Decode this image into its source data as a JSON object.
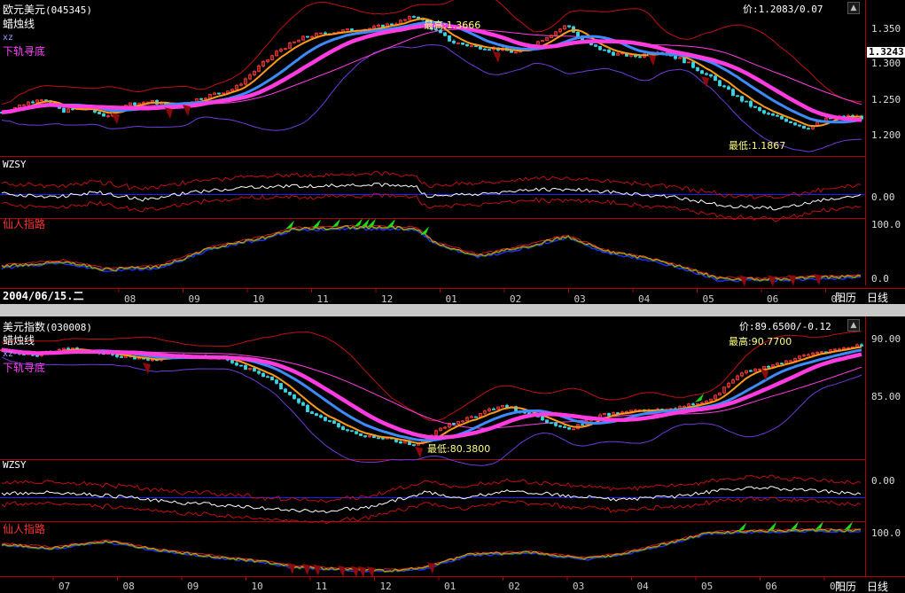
{
  "colors": {
    "bg": "#000000",
    "candle_up": "#ff3b3b",
    "candle_down": "#38d7e8",
    "ma_fast": "#ff9a1a",
    "ma_mid": "#3d8cff",
    "ma_slow": "#ff3ce0",
    "band_upper": "#c01010",
    "band_lower": "#6f3bd8",
    "oscillator": "#ffffff",
    "osc_band": "#c01010",
    "zero_line": "#2020ff",
    "signal_up": "#17e017",
    "signal_down": "#8b0a0a",
    "label_title": "#ffffff",
    "label_xz": "#9aa0ff",
    "label_lower": "#ff40ff",
    "label_xianren": "#ff3030",
    "hilo_text": "#ffff80"
  },
  "top": {
    "title": "欧元美元",
    "code": "(045345)",
    "price_label": "价:1.2083/0.07",
    "indicator": "蜡烛线",
    "sub1": "xz",
    "sub2": "下轨寻底",
    "high_label": "最高:1.3666",
    "low_label": "最低:1.1867",
    "current_value": "1.3243",
    "axis_ticks": [
      "1.350",
      "1.300",
      "1.250",
      "1.200"
    ],
    "osc_name": "WZSY",
    "osc_ticks": [
      "0.00"
    ],
    "xr_name": "仙人指路",
    "xr_ticks": [
      "100.0",
      "0.0"
    ]
  },
  "bottom": {
    "title": "美元指数",
    "code": "(030008)",
    "price_label": "价:89.6500/-0.12",
    "indicator": "蜡烛线",
    "sub1": "xz",
    "sub2": "下轨寻底",
    "high_label": "最高:90.7700",
    "low_label": "最低:80.3800",
    "axis_ticks": [
      "90.00",
      "85.00"
    ],
    "osc_name": "WZSY",
    "osc_ticks": [
      "0.00"
    ],
    "xr_name": "仙人指路",
    "xr_ticks": [
      "100.0"
    ]
  },
  "timebar": {
    "date": "2004/06/15.二",
    "months_top": [
      "08",
      "09",
      "10",
      "11",
      "12",
      "01",
      "02",
      "03",
      "04",
      "05",
      "06",
      "07"
    ],
    "months_bottom": [
      "07",
      "08",
      "09",
      "10",
      "11",
      "12",
      "01",
      "02",
      "03",
      "04",
      "05",
      "06",
      "07"
    ],
    "calendar_label": "阳历",
    "period_label": "日线"
  },
  "chart_data": [
    {
      "type": "candlestick",
      "title": "欧元美元",
      "ylim": [
        1.15,
        1.38
      ],
      "ticks": [
        1.35,
        1.3,
        1.25,
        1.2
      ],
      "current_value": 1.3243,
      "high": 1.3666,
      "low": 1.1867,
      "price_keypoints": [
        [
          0,
          1.215
        ],
        [
          20,
          1.225
        ],
        [
          45,
          1.238
        ],
        [
          70,
          1.218
        ],
        [
          95,
          1.222
        ],
        [
          120,
          1.21
        ],
        [
          140,
          1.228
        ],
        [
          170,
          1.232
        ],
        [
          195,
          1.226
        ],
        [
          220,
          1.235
        ],
        [
          245,
          1.245
        ],
        [
          265,
          1.252
        ],
        [
          290,
          1.282
        ],
        [
          315,
          1.31
        ],
        [
          345,
          1.33
        ],
        [
          380,
          1.338
        ],
        [
          420,
          1.343
        ],
        [
          450,
          1.352
        ],
        [
          470,
          1.362
        ],
        [
          485,
          1.345
        ],
        [
          510,
          1.322
        ],
        [
          535,
          1.315
        ],
        [
          560,
          1.312
        ],
        [
          585,
          1.305
        ],
        [
          610,
          1.325
        ],
        [
          640,
          1.348
        ],
        [
          660,
          1.32
        ],
        [
          690,
          1.305
        ],
        [
          720,
          1.3
        ],
        [
          740,
          1.31
        ],
        [
          770,
          1.295
        ],
        [
          800,
          1.27
        ],
        [
          830,
          1.24
        ],
        [
          860,
          1.215
        ],
        [
          885,
          1.205
        ],
        [
          910,
          1.192
        ],
        [
          935,
          1.207
        ],
        [
          960,
          1.21
        ],
        [
          975,
          1.208
        ]
      ],
      "signals_down": [
        130,
        190,
        210,
        560,
        735,
        795
      ],
      "oscillator_keypoints": [
        [
          0,
          0.005
        ],
        [
          60,
          -0.01
        ],
        [
          110,
          0.01
        ],
        [
          160,
          -0.02
        ],
        [
          220,
          0.01
        ],
        [
          290,
          0.03
        ],
        [
          360,
          0.035
        ],
        [
          420,
          0.04
        ],
        [
          470,
          0.03
        ],
        [
          480,
          -0.005
        ],
        [
          540,
          0.0
        ],
        [
          600,
          0.02
        ],
        [
          650,
          0.02
        ],
        [
          700,
          0.005
        ],
        [
          760,
          -0.01
        ],
        [
          820,
          -0.045
        ],
        [
          880,
          -0.055
        ],
        [
          930,
          -0.02
        ],
        [
          975,
          -0.005
        ]
      ],
      "xianren_keypoints": [
        [
          0,
          25
        ],
        [
          70,
          35
        ],
        [
          120,
          20
        ],
        [
          180,
          25
        ],
        [
          240,
          60
        ],
        [
          300,
          80
        ],
        [
          330,
          95
        ],
        [
          400,
          98
        ],
        [
          470,
          96
        ],
        [
          490,
          70
        ],
        [
          540,
          45
        ],
        [
          600,
          65
        ],
        [
          640,
          82
        ],
        [
          680,
          55
        ],
        [
          730,
          40
        ],
        [
          780,
          20
        ],
        [
          810,
          3
        ],
        [
          860,
          2
        ],
        [
          920,
          5
        ],
        [
          975,
          8
        ]
      ],
      "xianren_up_signals": [
        328,
        358,
        380,
        405,
        413,
        420,
        442,
        480
      ],
      "xianren_down_signals": [
        838,
        870,
        893,
        922
      ]
    },
    {
      "type": "candlestick",
      "title": "美元指数",
      "ylim": [
        79.5,
        92.5
      ],
      "ticks": [
        90.0,
        85.0
      ],
      "high": 90.77,
      "low": 80.38,
      "price_keypoints": [
        [
          0,
          89.6
        ],
        [
          40,
          89.2
        ],
        [
          80,
          89.8
        ],
        [
          110,
          89.4
        ],
        [
          165,
          88.7
        ],
        [
          210,
          89.2
        ],
        [
          250,
          88.9
        ],
        [
          300,
          87.2
        ],
        [
          350,
          83.8
        ],
        [
          400,
          81.8
        ],
        [
          440,
          81.3
        ],
        [
          470,
          80.8
        ],
        [
          500,
          82.5
        ],
        [
          540,
          83.6
        ],
        [
          565,
          84.6
        ],
        [
          600,
          83.6
        ],
        [
          640,
          82.2
        ],
        [
          680,
          83.6
        ],
        [
          720,
          84.0
        ],
        [
          760,
          84.1
        ],
        [
          800,
          85.0
        ],
        [
          840,
          87.6
        ],
        [
          880,
          88.5
        ],
        [
          920,
          89.4
        ],
        [
          950,
          89.7
        ],
        [
          975,
          90.2
        ]
      ],
      "signals_down": [
        165,
        472,
        862
      ],
      "signals_up": [
        790
      ],
      "oscillator_keypoints": [
        [
          0,
          0.3
        ],
        [
          50,
          0.5
        ],
        [
          120,
          0.2
        ],
        [
          200,
          -0.4
        ],
        [
          300,
          -0.9
        ],
        [
          360,
          -1.2
        ],
        [
          420,
          -0.8
        ],
        [
          480,
          0.5
        ],
        [
          520,
          0.0
        ],
        [
          580,
          0.6
        ],
        [
          640,
          0.2
        ],
        [
          700,
          -0.2
        ],
        [
          760,
          0.1
        ],
        [
          820,
          0.7
        ],
        [
          860,
          0.9
        ],
        [
          920,
          0.6
        ],
        [
          975,
          0.3
        ]
      ],
      "xianren_keypoints": [
        [
          0,
          65
        ],
        [
          60,
          55
        ],
        [
          120,
          72
        ],
        [
          180,
          50
        ],
        [
          240,
          35
        ],
        [
          300,
          22
        ],
        [
          330,
          10
        ],
        [
          400,
          3
        ],
        [
          440,
          1
        ],
        [
          480,
          8
        ],
        [
          530,
          40
        ],
        [
          600,
          45
        ],
        [
          660,
          30
        ],
        [
          700,
          40
        ],
        [
          760,
          70
        ],
        [
          800,
          92
        ],
        [
          860,
          96
        ],
        [
          920,
          98
        ],
        [
          975,
          97
        ]
      ],
      "xianren_up_signals": [
        838,
        872,
        897,
        925,
        958
      ],
      "xianren_down_signals": [
        328,
        345,
        357,
        385,
        400,
        408,
        418,
        486
      ]
    }
  ]
}
